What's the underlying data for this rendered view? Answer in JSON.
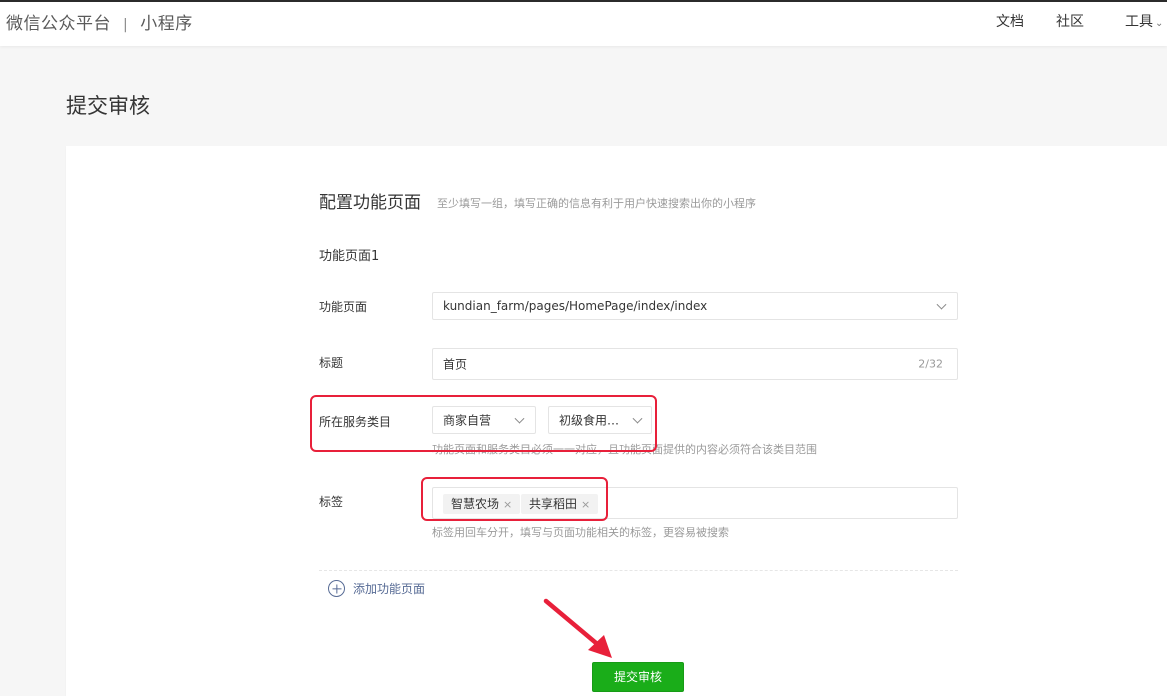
{
  "header": {
    "brand": "微信公众平台",
    "separator": "|",
    "product": "小程序",
    "nav": {
      "docs": "文档",
      "community": "社区",
      "tools": "工具"
    }
  },
  "page": {
    "title": "提交审核"
  },
  "section": {
    "title": "配置功能页面",
    "hint": "至少填写一组，填写正确的信息有利于用户快速搜索出你的小程序"
  },
  "group": {
    "title": "功能页面1",
    "function_page": {
      "label": "功能页面",
      "value": "kundian_farm/pages/HomePage/index/index"
    },
    "title_field": {
      "label": "标题",
      "value": "首页",
      "counter": "2/32"
    },
    "category": {
      "label": "所在服务类目",
      "primary": "商家自营",
      "secondary": "初级食用…",
      "help": "功能页面和服务类目必须一一对应，且功能页面提供的内容必须符合该类目范围"
    },
    "tags": {
      "label": "标签",
      "items": [
        "智慧农场",
        "共享稻田"
      ],
      "remove_glyph": "×",
      "help": "标签用回车分开，填写与页面功能相关的标签，更容易被搜索"
    }
  },
  "actions": {
    "add_page": "添加功能页面",
    "submit": "提交审核"
  },
  "colors": {
    "primary_green": "#1aad19",
    "link_blue": "#576b95",
    "annotation_red": "#e8203a"
  }
}
